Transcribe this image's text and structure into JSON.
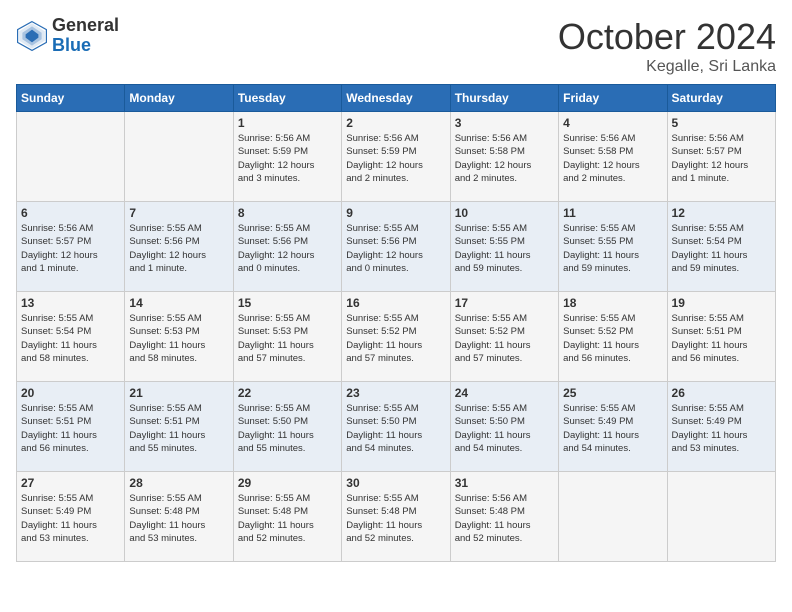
{
  "header": {
    "logo_general": "General",
    "logo_blue": "Blue",
    "month_title": "October 2024",
    "location": "Kegalle, Sri Lanka"
  },
  "days_of_week": [
    "Sunday",
    "Monday",
    "Tuesday",
    "Wednesday",
    "Thursday",
    "Friday",
    "Saturday"
  ],
  "weeks": [
    [
      {
        "day": "",
        "info": ""
      },
      {
        "day": "",
        "info": ""
      },
      {
        "day": "1",
        "info": "Sunrise: 5:56 AM\nSunset: 5:59 PM\nDaylight: 12 hours\nand 3 minutes."
      },
      {
        "day": "2",
        "info": "Sunrise: 5:56 AM\nSunset: 5:59 PM\nDaylight: 12 hours\nand 2 minutes."
      },
      {
        "day": "3",
        "info": "Sunrise: 5:56 AM\nSunset: 5:58 PM\nDaylight: 12 hours\nand 2 minutes."
      },
      {
        "day": "4",
        "info": "Sunrise: 5:56 AM\nSunset: 5:58 PM\nDaylight: 12 hours\nand 2 minutes."
      },
      {
        "day": "5",
        "info": "Sunrise: 5:56 AM\nSunset: 5:57 PM\nDaylight: 12 hours\nand 1 minute."
      }
    ],
    [
      {
        "day": "6",
        "info": "Sunrise: 5:56 AM\nSunset: 5:57 PM\nDaylight: 12 hours\nand 1 minute."
      },
      {
        "day": "7",
        "info": "Sunrise: 5:55 AM\nSunset: 5:56 PM\nDaylight: 12 hours\nand 1 minute."
      },
      {
        "day": "8",
        "info": "Sunrise: 5:55 AM\nSunset: 5:56 PM\nDaylight: 12 hours\nand 0 minutes."
      },
      {
        "day": "9",
        "info": "Sunrise: 5:55 AM\nSunset: 5:56 PM\nDaylight: 12 hours\nand 0 minutes."
      },
      {
        "day": "10",
        "info": "Sunrise: 5:55 AM\nSunset: 5:55 PM\nDaylight: 11 hours\nand 59 minutes."
      },
      {
        "day": "11",
        "info": "Sunrise: 5:55 AM\nSunset: 5:55 PM\nDaylight: 11 hours\nand 59 minutes."
      },
      {
        "day": "12",
        "info": "Sunrise: 5:55 AM\nSunset: 5:54 PM\nDaylight: 11 hours\nand 59 minutes."
      }
    ],
    [
      {
        "day": "13",
        "info": "Sunrise: 5:55 AM\nSunset: 5:54 PM\nDaylight: 11 hours\nand 58 minutes."
      },
      {
        "day": "14",
        "info": "Sunrise: 5:55 AM\nSunset: 5:53 PM\nDaylight: 11 hours\nand 58 minutes."
      },
      {
        "day": "15",
        "info": "Sunrise: 5:55 AM\nSunset: 5:53 PM\nDaylight: 11 hours\nand 57 minutes."
      },
      {
        "day": "16",
        "info": "Sunrise: 5:55 AM\nSunset: 5:52 PM\nDaylight: 11 hours\nand 57 minutes."
      },
      {
        "day": "17",
        "info": "Sunrise: 5:55 AM\nSunset: 5:52 PM\nDaylight: 11 hours\nand 57 minutes."
      },
      {
        "day": "18",
        "info": "Sunrise: 5:55 AM\nSunset: 5:52 PM\nDaylight: 11 hours\nand 56 minutes."
      },
      {
        "day": "19",
        "info": "Sunrise: 5:55 AM\nSunset: 5:51 PM\nDaylight: 11 hours\nand 56 minutes."
      }
    ],
    [
      {
        "day": "20",
        "info": "Sunrise: 5:55 AM\nSunset: 5:51 PM\nDaylight: 11 hours\nand 56 minutes."
      },
      {
        "day": "21",
        "info": "Sunrise: 5:55 AM\nSunset: 5:51 PM\nDaylight: 11 hours\nand 55 minutes."
      },
      {
        "day": "22",
        "info": "Sunrise: 5:55 AM\nSunset: 5:50 PM\nDaylight: 11 hours\nand 55 minutes."
      },
      {
        "day": "23",
        "info": "Sunrise: 5:55 AM\nSunset: 5:50 PM\nDaylight: 11 hours\nand 54 minutes."
      },
      {
        "day": "24",
        "info": "Sunrise: 5:55 AM\nSunset: 5:50 PM\nDaylight: 11 hours\nand 54 minutes."
      },
      {
        "day": "25",
        "info": "Sunrise: 5:55 AM\nSunset: 5:49 PM\nDaylight: 11 hours\nand 54 minutes."
      },
      {
        "day": "26",
        "info": "Sunrise: 5:55 AM\nSunset: 5:49 PM\nDaylight: 11 hours\nand 53 minutes."
      }
    ],
    [
      {
        "day": "27",
        "info": "Sunrise: 5:55 AM\nSunset: 5:49 PM\nDaylight: 11 hours\nand 53 minutes."
      },
      {
        "day": "28",
        "info": "Sunrise: 5:55 AM\nSunset: 5:48 PM\nDaylight: 11 hours\nand 53 minutes."
      },
      {
        "day": "29",
        "info": "Sunrise: 5:55 AM\nSunset: 5:48 PM\nDaylight: 11 hours\nand 52 minutes."
      },
      {
        "day": "30",
        "info": "Sunrise: 5:55 AM\nSunset: 5:48 PM\nDaylight: 11 hours\nand 52 minutes."
      },
      {
        "day": "31",
        "info": "Sunrise: 5:56 AM\nSunset: 5:48 PM\nDaylight: 11 hours\nand 52 minutes."
      },
      {
        "day": "",
        "info": ""
      },
      {
        "day": "",
        "info": ""
      }
    ]
  ]
}
